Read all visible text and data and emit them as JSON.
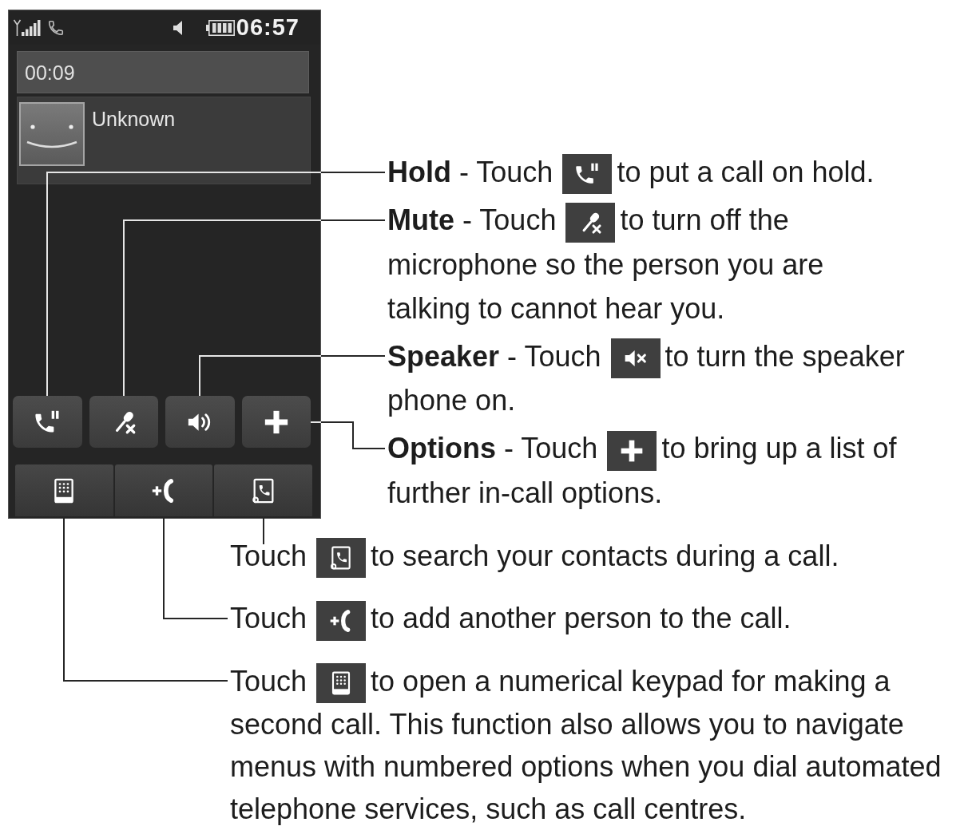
{
  "phone": {
    "status_bar": {
      "time": "06:57"
    },
    "call_timer": "00:09",
    "caller": {
      "name": "Unknown"
    },
    "call_buttons": [
      {
        "kind": "hold"
      },
      {
        "kind": "mute"
      },
      {
        "kind": "speaker"
      },
      {
        "kind": "options"
      }
    ],
    "bottom_buttons": [
      {
        "kind": "keypad"
      },
      {
        "kind": "add_call"
      },
      {
        "kind": "contacts"
      }
    ]
  },
  "side_notes": [
    {
      "kind": "hold",
      "lead": "**Hold** - Touch",
      "rest": "to put a call on hold."
    },
    {
      "kind": "mute",
      "lead": "**Mute** - Touch",
      "rest": "to turn off the",
      "more": "microphone so the person you are talking to cannot hear you."
    },
    {
      "kind": "speaker",
      "lead": "**Speaker** - Touch",
      "rest": "to turn the speaker",
      "more": "phone on."
    },
    {
      "kind": "options",
      "lead": "**Options** - Touch",
      "rest": "to bring up a list of",
      "more": "further in-call options."
    }
  ],
  "bottom_notes": [
    {
      "kind": "contacts",
      "lead": "Touch",
      "rest": "to search your contacts during a call."
    },
    {
      "kind": "add_call",
      "lead": "Touch",
      "rest": "to add another person to the call."
    },
    {
      "kind": "keypad",
      "lead": "Touch",
      "rest": "to open a numerical keypad for making a",
      "more": "second call. This function also allows you to navigate menus with numbered options when you dial automated telephone services, such as call centres."
    }
  ]
}
